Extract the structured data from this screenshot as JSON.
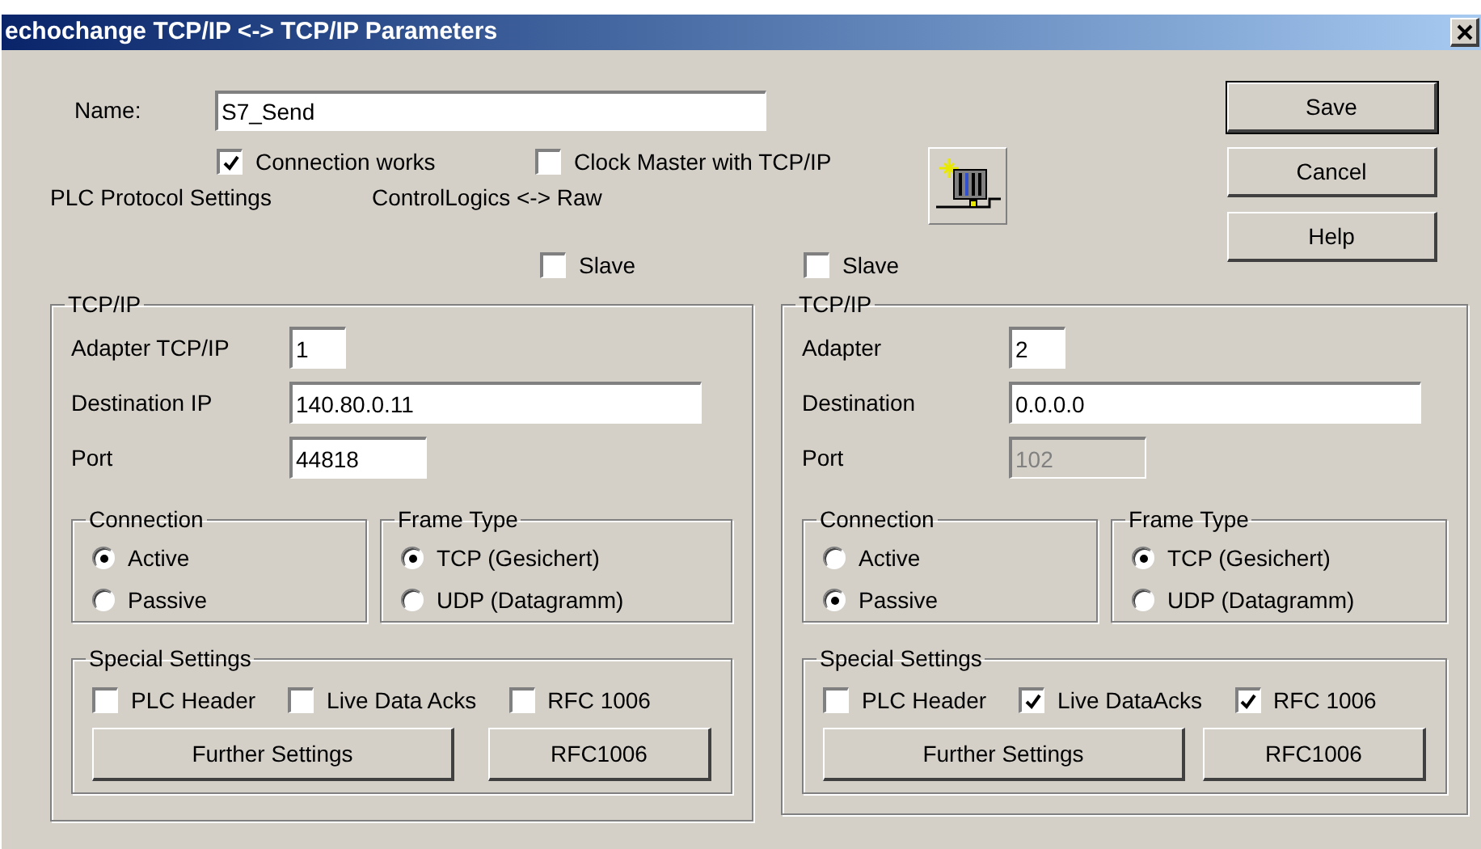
{
  "window": {
    "title": "echochange TCP/IP <-> TCP/IP Parameters"
  },
  "name_field": {
    "label": "Name:",
    "value": "S7_Send"
  },
  "options": [
    {
      "label": "Connection works",
      "checked": true
    },
    {
      "label": "Clock Master with TCP/IP",
      "checked": false
    }
  ],
  "protocol": {
    "label": "PLC Protocol Settings",
    "value": "ControlLogics <-> Raw"
  },
  "buttons": [
    {
      "label": "Save",
      "default": true
    },
    {
      "label": "Cancel",
      "default": false
    },
    {
      "label": "Help",
      "default": false
    }
  ],
  "sides": [
    {
      "slave": {
        "label": "Slave",
        "checked": false
      },
      "title": "TCP/IP",
      "fields": [
        {
          "label": "Adapter TCP/IP",
          "value": "1",
          "disabled": false
        },
        {
          "label": "Destination IP",
          "value": "140.80.0.11",
          "disabled": false
        },
        {
          "label": "Port",
          "value": "44818",
          "disabled": false
        }
      ],
      "connection": {
        "title": "Connection",
        "options": [
          {
            "label": "Active",
            "selected": true
          },
          {
            "label": "Passive",
            "selected": false
          }
        ]
      },
      "frame_type": {
        "title": "Frame Type",
        "options": [
          {
            "label": "TCP (Gesichert)",
            "selected": true
          },
          {
            "label": "UDP (Datagramm)",
            "selected": false
          }
        ]
      },
      "special": {
        "title": "Special Settings",
        "checks": [
          {
            "label": "PLC Header",
            "checked": false
          },
          {
            "label": "Live Data Acks",
            "checked": false
          },
          {
            "label": "RFC 1006",
            "checked": false
          }
        ],
        "buttons": [
          "Further Settings",
          "RFC1006"
        ]
      }
    },
    {
      "slave": {
        "label": "Slave",
        "checked": false
      },
      "title": "TCP/IP",
      "fields": [
        {
          "label": "Adapter",
          "value": "2",
          "disabled": false
        },
        {
          "label": "Destination",
          "value": "0.0.0.0",
          "disabled": false
        },
        {
          "label": "Port",
          "value": "102",
          "disabled": true
        }
      ],
      "connection": {
        "title": "Connection",
        "options": [
          {
            "label": "Active",
            "selected": false
          },
          {
            "label": "Passive",
            "selected": true
          }
        ]
      },
      "frame_type": {
        "title": "Frame Type",
        "options": [
          {
            "label": "TCP (Gesichert)",
            "selected": true
          },
          {
            "label": "UDP (Datagramm)",
            "selected": false
          }
        ]
      },
      "special": {
        "title": "Special Settings",
        "checks": [
          {
            "label": "PLC Header",
            "checked": false
          },
          {
            "label": "Live DataAcks",
            "checked": true
          },
          {
            "label": "RFC 1006",
            "checked": true
          }
        ],
        "buttons": [
          "Further Settings",
          "RFC1006"
        ]
      }
    }
  ]
}
